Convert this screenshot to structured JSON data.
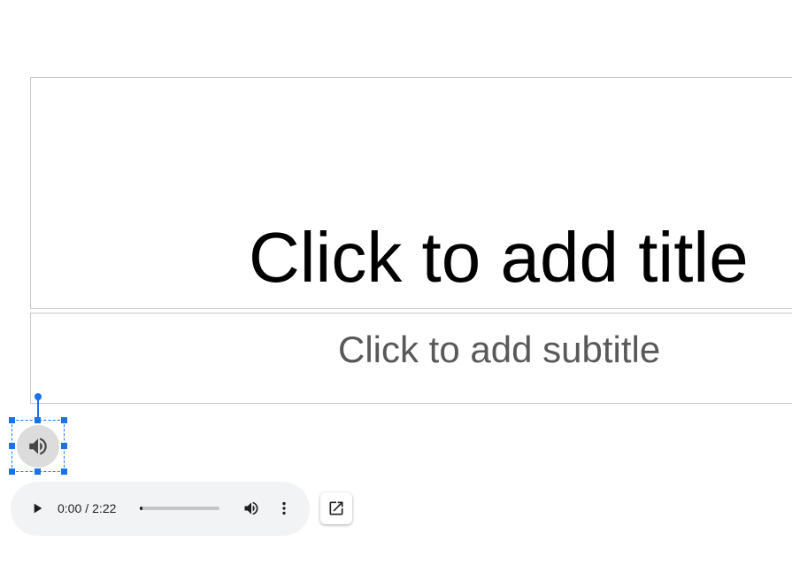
{
  "slide": {
    "title_placeholder": "Click to add title",
    "subtitle_placeholder": "Click to add subtitle"
  },
  "audio_object": {
    "icon": "speaker-volume-icon",
    "selected": true,
    "selection_color": "#1a73e8"
  },
  "player": {
    "current_time": "0:00",
    "separator": "/",
    "duration": "2:22",
    "progress_fraction": 0.0,
    "icons": {
      "play": "play-icon",
      "volume": "volume-icon",
      "more": "more-vertical-icon"
    }
  },
  "open_external": {
    "icon": "open-in-new-icon"
  }
}
